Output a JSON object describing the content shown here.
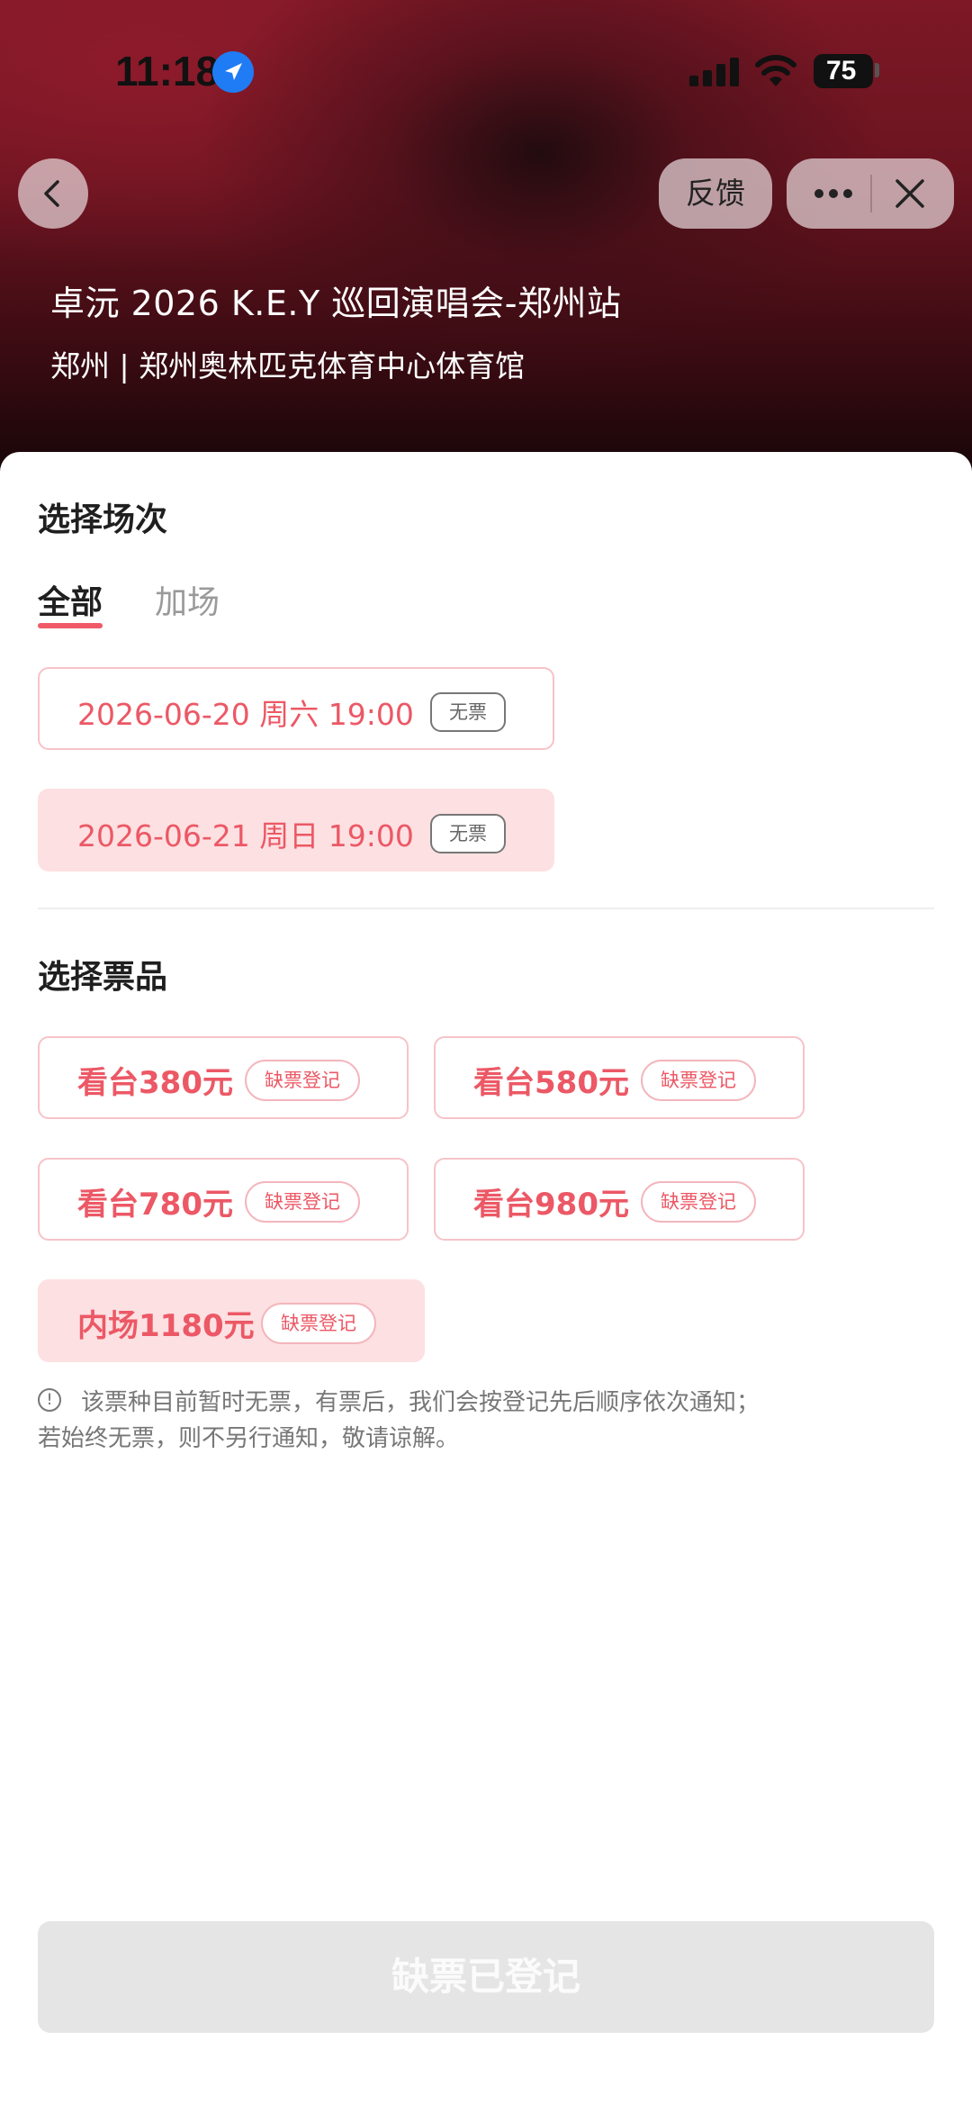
{
  "status_bar": {
    "time": "11:18",
    "battery": "75"
  },
  "header": {
    "feedback_label": "反馈",
    "event_title": "卓沅 2026 K.E.Y 巡回演唱会-郑州站",
    "event_venue": "郑州 | 郑州奥林匹克体育中心体育馆"
  },
  "session_section": {
    "title": "选择场次",
    "tabs": [
      {
        "label": "全部",
        "active": true
      },
      {
        "label": "加场",
        "active": false
      }
    ],
    "sessions": [
      {
        "label": "2026-06-20 周六 19:00",
        "tag": "无票",
        "selected": false
      },
      {
        "label": "2026-06-21 周日 19:00",
        "tag": "无票",
        "selected": true
      }
    ]
  },
  "ticket_section": {
    "title": "选择票品",
    "tiers": [
      {
        "label": "看台380元",
        "tag": "缺票登记",
        "selected": false
      },
      {
        "label": "看台580元",
        "tag": "缺票登记",
        "selected": false
      },
      {
        "label": "看台780元",
        "tag": "缺票登记",
        "selected": false
      },
      {
        "label": "看台980元",
        "tag": "缺票登记",
        "selected": false
      },
      {
        "label": "内场1180元",
        "tag": "缺票登记",
        "selected": true
      }
    ]
  },
  "notice": {
    "line1": "该票种目前暂时无票，有票后，我们会按登记先后顺序依次通知；",
    "line2": "若始终无票，则不另行通知，敬请谅解。"
  },
  "bottom_button": {
    "label": "缺票已登记"
  },
  "colors": {
    "accent": "#ec5865",
    "selected_bg": "#fde0e2",
    "border": "#f6c3c8",
    "disabled_button": "#e5e5e5"
  }
}
